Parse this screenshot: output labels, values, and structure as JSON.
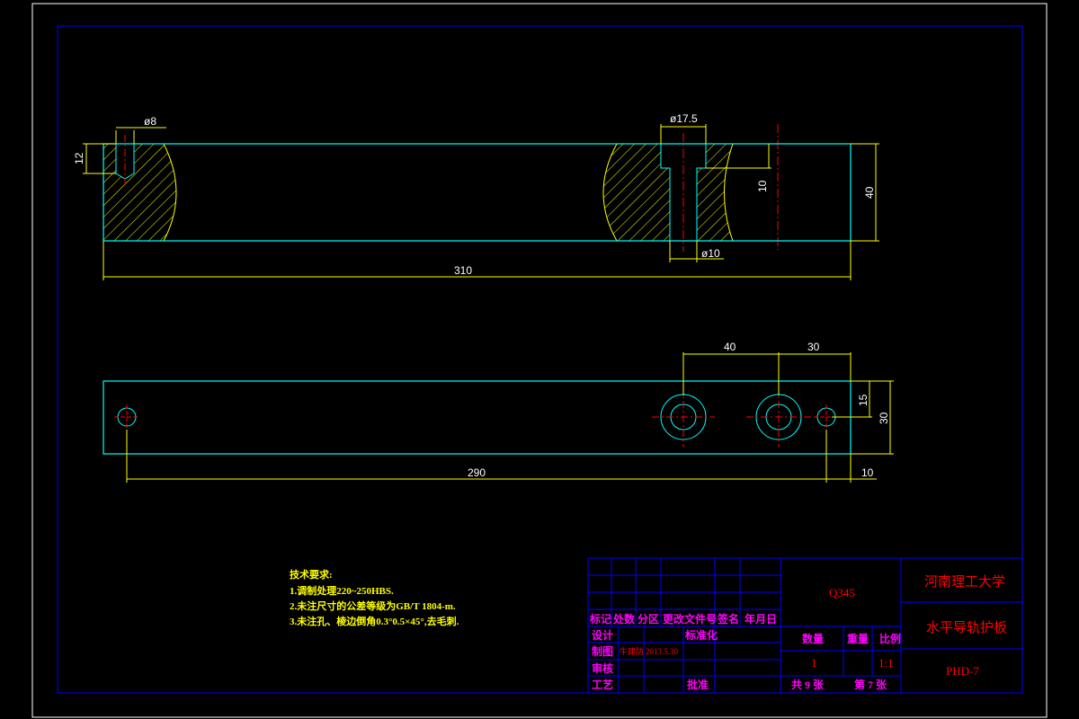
{
  "colors": {
    "background": "#000000",
    "frame": "#ffffff",
    "border": "#0000ff",
    "part_outline": "#00ffff",
    "hatch": "#ffff00",
    "centerline": "#ff0000",
    "dimension_line": "#ffff00",
    "dimension_text": "#ffffff",
    "titleblock_label": "#ff00ff",
    "titleblock_value": "#ff0000"
  },
  "front_view": {
    "dims": {
      "hole_small_dia": "ø8",
      "hole_depth": "12",
      "counterbore_dia": "ø17.5",
      "counterbore_depth": "10",
      "through_hole_dia": "ø10",
      "height": "40",
      "length": "310"
    }
  },
  "top_view": {
    "dims": {
      "hole_spacing_1": "40",
      "hole_spacing_2": "30",
      "edge_offset_y": "15",
      "width": "30",
      "hole_span": "290",
      "edge_offset_x": "10"
    }
  },
  "notes": {
    "title": "技术要求:",
    "items": [
      "1.调制处理220~250HBS.",
      "2.未注尺寸的公差等级为GB/T 1804-m.",
      "3.未注孔、棱边倒角0.3°0.5×45°,去毛刺."
    ]
  },
  "title_block": {
    "headers": [
      "标记",
      "处数",
      "分区",
      "更改文件号",
      "签名",
      "年月日"
    ],
    "row_design": {
      "label": "设计",
      "std_label": "标准化"
    },
    "row_draw": {
      "label": "制图",
      "name": "牛建防",
      "date": "2013.5.30"
    },
    "row_review": {
      "label": "审核"
    },
    "row_process": {
      "label": "工艺",
      "approve_label": "批准"
    },
    "material": "Q345",
    "qty_label": "数量",
    "weight_label": "重量",
    "scale_label": "比例",
    "qty_value": "1",
    "scale_value": "1:1",
    "sheets_total": "共 9 张",
    "sheet_no": "第 7 张",
    "school": "河南理工大学",
    "part_name": "水平导轨护板",
    "drawing_no": "PHD-7"
  }
}
